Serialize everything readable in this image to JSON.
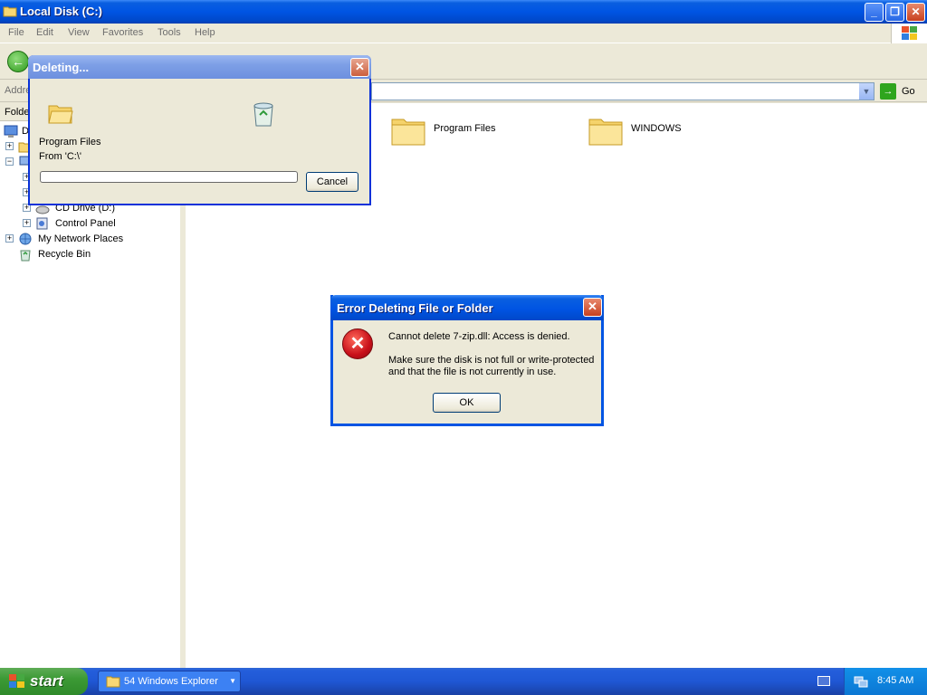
{
  "window": {
    "title": "Local Disk (C:)"
  },
  "menu": [
    "File",
    "Edit",
    "View",
    "Favorites",
    "Tools",
    "Help"
  ],
  "address": {
    "label": "Addre",
    "go_label": "Go"
  },
  "folders_pane": {
    "header": "Folde",
    "items": [
      {
        "label": "D",
        "icon": "desktop-icon"
      },
      {
        "label": "",
        "icon": "folder-icon"
      },
      {
        "label": "",
        "icon": "computer-icon"
      },
      {
        "label": "",
        "icon": "drive-icon"
      },
      {
        "label": "",
        "icon": "drive-icon"
      },
      {
        "label": "CD Drive (D:)",
        "icon": "cd-drive-icon"
      },
      {
        "label": "Control Panel",
        "icon": "control-panel-icon"
      },
      {
        "label": "My Network Places",
        "icon": "network-icon"
      },
      {
        "label": "Recycle Bin",
        "icon": "recycle-bin-icon"
      }
    ]
  },
  "content": {
    "folders": [
      "Program Files",
      "WINDOWS"
    ]
  },
  "deleting_dialog": {
    "title": "Deleting...",
    "item_name": "Program Files",
    "from_text": "From 'C:\\'",
    "progress": 0,
    "cancel_label": "Cancel"
  },
  "error_dialog": {
    "title": "Error Deleting File or Folder",
    "message1": "Cannot delete 7-zip.dll: Access is denied.",
    "message2": "Make sure the disk is not full or write-protected and that the file is not currently in use.",
    "ok_label": "OK"
  },
  "taskbar": {
    "start_label": "start",
    "group_count": "54",
    "group_label": "Windows Explorer",
    "clock": "8:45 AM"
  },
  "colors": {
    "xp_blue": "#0054e3",
    "taskbar_blue": "#245edb",
    "start_green": "#3c9a35",
    "dialog_bg": "#ece9d8"
  }
}
